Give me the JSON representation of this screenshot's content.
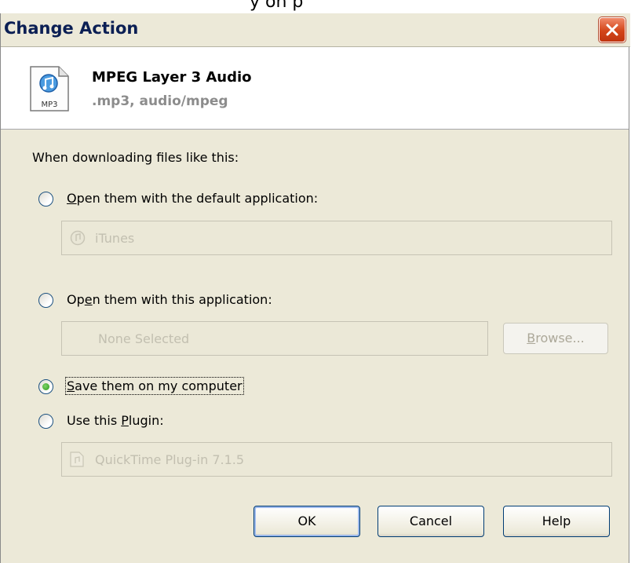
{
  "page_heading_fragment": "y on p",
  "window": {
    "title": "Change Action",
    "close_icon": "close-icon"
  },
  "file_type": {
    "icon": "mp3-file-icon",
    "icon_label": "MP3",
    "name": "MPEG Layer 3 Audio",
    "extension": ".mp3, audio/mpeg"
  },
  "prompt": "When downloading files like this:",
  "options": {
    "default_app": {
      "label_prefix": "",
      "label_key": "O",
      "label_rest": "pen them with the default application:",
      "checked": false,
      "field_value": "iTunes",
      "field_icon": "itunes-icon"
    },
    "this_app": {
      "label_prefix": "Op",
      "label_key": "e",
      "label_rest": "n them with this application:",
      "checked": false,
      "field_value": "None Selected",
      "browse_key": "B",
      "browse_rest": "rowse..."
    },
    "save": {
      "label_prefix": "",
      "label_key": "S",
      "label_rest": "ave them on my computer",
      "checked": true
    },
    "plugin": {
      "label_prefix": "Use this ",
      "label_key": "P",
      "label_rest": "lugin:",
      "checked": false,
      "field_value": "QuickTime Plug-in 7.1.5",
      "field_icon": "quicktime-plugin-icon"
    }
  },
  "buttons": {
    "ok": "OK",
    "cancel": "Cancel",
    "help": "Help"
  },
  "colors": {
    "dialog_bg": "#ece9d8",
    "title_text": "#0b1f54",
    "disabled_text": "#c2bfb0",
    "radio_checked": "#2a9a17"
  }
}
